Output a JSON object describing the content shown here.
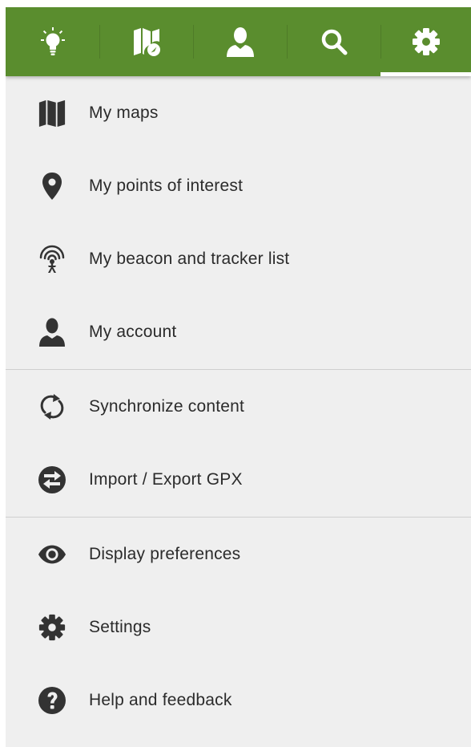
{
  "tabs": [
    {
      "name": "tips",
      "icon": "lightbulb-icon",
      "active": false
    },
    {
      "name": "maps",
      "icon": "map-compass-icon",
      "active": false
    },
    {
      "name": "account",
      "icon": "person-icon",
      "active": false
    },
    {
      "name": "search",
      "icon": "search-icon",
      "active": false
    },
    {
      "name": "settings",
      "icon": "gear-icon",
      "active": true
    }
  ],
  "menu": {
    "group1": [
      {
        "label": "My maps",
        "icon": "map-icon"
      },
      {
        "label": "My points of interest",
        "icon": "location-pin-icon"
      },
      {
        "label": "My beacon and tracker list",
        "icon": "beacon-tracker-icon"
      },
      {
        "label": "My account",
        "icon": "person-icon"
      }
    ],
    "group2": [
      {
        "label": "Synchronize content",
        "icon": "sync-icon"
      },
      {
        "label": "Import / Export GPX",
        "icon": "import-export-icon"
      }
    ],
    "group3": [
      {
        "label": "Display preferences",
        "icon": "eye-icon"
      },
      {
        "label": "Settings",
        "icon": "gear-icon"
      },
      {
        "label": "Help and feedback",
        "icon": "help-icon"
      }
    ]
  },
  "colors": {
    "tabbar_bg": "#5a8d2e",
    "active_indicator": "#ffffff",
    "menu_bg": "#efefef",
    "icon_color": "#333333",
    "divider": "#cfcfcf"
  }
}
